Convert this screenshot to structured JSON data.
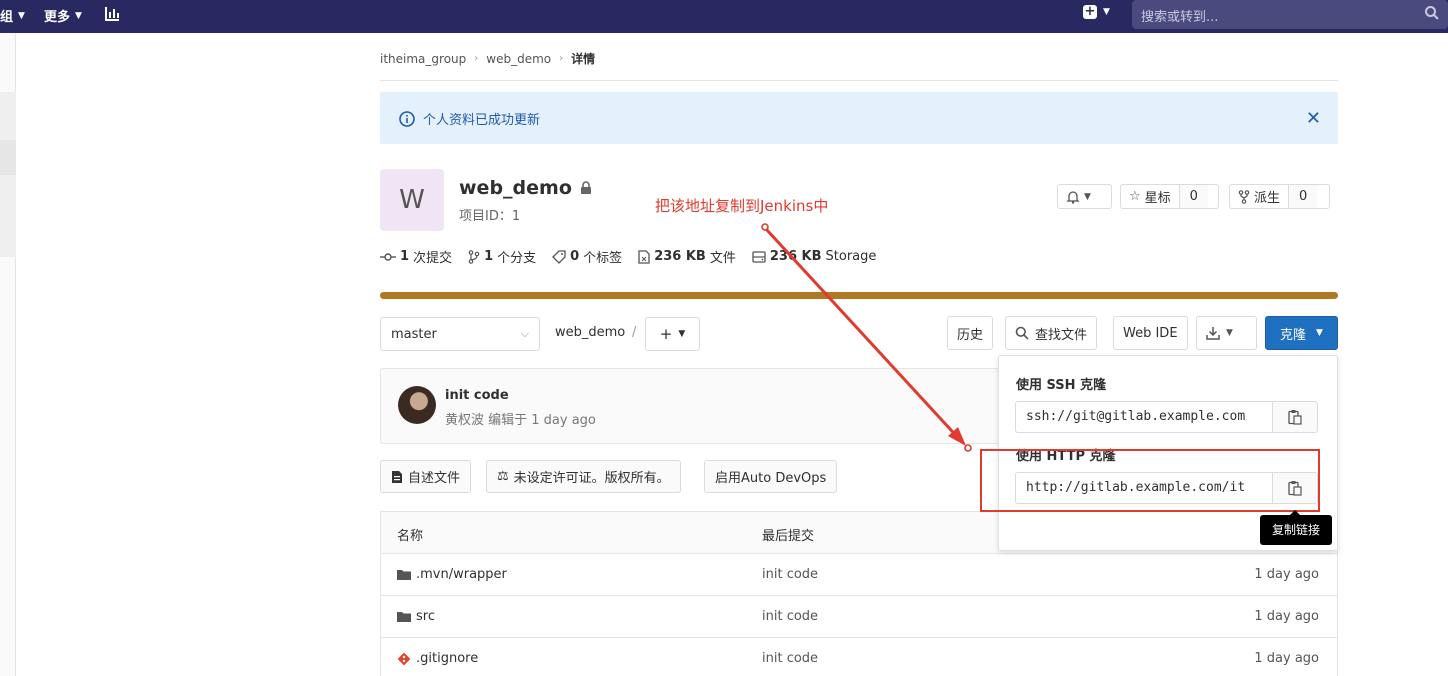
{
  "topnav": {
    "group_fragment": "组",
    "more_label": "更多",
    "search_placeholder": "搜索或转到..."
  },
  "breadcrumb": [
    "itheima_group",
    "web_demo",
    "详情"
  ],
  "flash": {
    "message": "个人资料已成功更新"
  },
  "project": {
    "avatar_letter": "W",
    "name": "web_demo",
    "id_label": "项目ID：1"
  },
  "annotation": {
    "text": "把该地址复制到Jenkins中"
  },
  "header_buttons": {
    "star_label": "星标",
    "star_count": "0",
    "fork_label": "派生",
    "fork_count": "0"
  },
  "stats": [
    {
      "icon": "commit-icon",
      "num": "1",
      "label": "次提交"
    },
    {
      "icon": "branch-icon",
      "num": "1",
      "label": "个分支"
    },
    {
      "icon": "tag-icon",
      "num": "0",
      "label": "个标签"
    },
    {
      "icon": "file-icon",
      "num": "236 KB",
      "label": "文件"
    },
    {
      "icon": "storage-icon",
      "num": "236 KB",
      "label": "Storage"
    }
  ],
  "colors": {
    "language_bar": "#b07820",
    "clone_button": "#1f70c1",
    "annotation": "#e03b2f"
  },
  "toolbar": {
    "branch": "master",
    "path": "web_demo",
    "path_sep": "/",
    "history": "历史",
    "find_file": "查找文件",
    "web_ide": "Web IDE",
    "clone": "克隆"
  },
  "commit": {
    "title": "init code",
    "meta": "黄权波 编辑于 1 day ago"
  },
  "info_buttons": {
    "readme": "自述文件",
    "license": "未设定许可证。版权所有。",
    "devops": "启用Auto DevOps"
  },
  "clone_dropdown": {
    "ssh_label": "使用 SSH 克隆",
    "ssh_url": "ssh://git@gitlab.example.com",
    "http_label": "使用 HTTP 克隆",
    "http_url": "http://gitlab.example.com/it",
    "tooltip": "复制链接"
  },
  "file_table": {
    "headers": [
      "名称",
      "最后提交",
      ""
    ],
    "rows": [
      {
        "name": ".mvn/wrapper",
        "icon": "folder-icon",
        "commit": "init code",
        "time": "1 day ago"
      },
      {
        "name": "src",
        "icon": "folder-icon",
        "commit": "init code",
        "time": "1 day ago"
      },
      {
        "name": ".gitignore",
        "icon": "git-icon",
        "commit": "init code",
        "time": "1 day ago"
      }
    ]
  }
}
